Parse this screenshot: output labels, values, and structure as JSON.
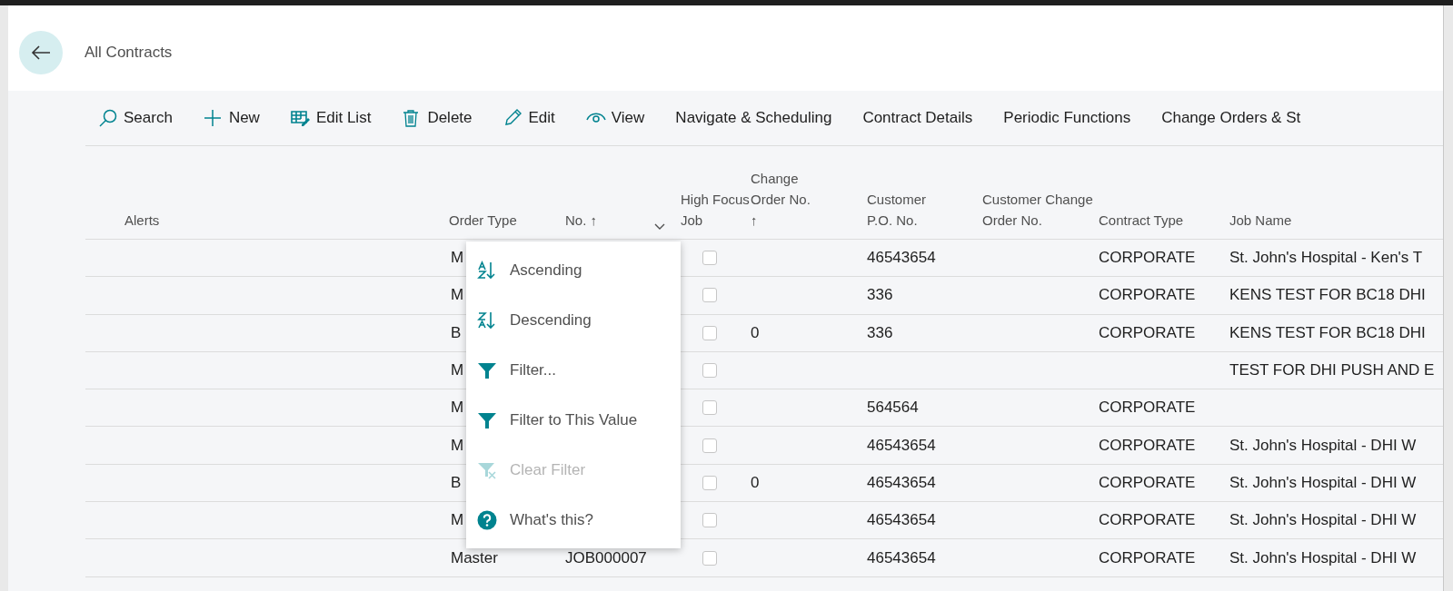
{
  "page": {
    "title": "All Contracts"
  },
  "toolbar": [
    {
      "kind": "search",
      "label": "Search"
    },
    {
      "kind": "new",
      "label": "New"
    },
    {
      "kind": "edit-list",
      "label": "Edit List"
    },
    {
      "kind": "delete",
      "label": "Delete"
    },
    {
      "kind": "edit",
      "label": "Edit"
    },
    {
      "kind": "view",
      "label": "View"
    },
    {
      "kind": "menu",
      "label": "Navigate & Scheduling"
    },
    {
      "kind": "menu",
      "label": "Contract Details"
    },
    {
      "kind": "menu",
      "label": "Periodic Functions"
    },
    {
      "kind": "menu",
      "label": "Change Orders & St"
    }
  ],
  "table": {
    "columns": [
      {
        "label": "Alerts"
      },
      {
        "label": "Order Type"
      },
      {
        "label": "No. ↑",
        "menu_open": true
      },
      {
        "label": "High Focus Job"
      },
      {
        "label": "Change Order No. ↑"
      },
      {
        "label": "Customer P.O. No."
      },
      {
        "label": "Customer Change Order No."
      },
      {
        "label": "Contract Type"
      },
      {
        "label": "Job Name"
      }
    ],
    "rows": [
      {
        "order_type": "M",
        "high_focus": false,
        "customer_po": "46543654",
        "contract_type": "CORPORATE",
        "job_name": "St. John's Hospital - Ken's T"
      },
      {
        "order_type": "M",
        "high_focus": false,
        "customer_po": "336",
        "contract_type": "CORPORATE",
        "job_name": "KENS TEST FOR BC18 DHI"
      },
      {
        "order_type": "B",
        "high_focus": false,
        "change_order": "0",
        "customer_po": "336",
        "contract_type": "CORPORATE",
        "job_name": "KENS TEST FOR BC18 DHI"
      },
      {
        "order_type": "M",
        "high_focus": false,
        "job_name": "TEST FOR DHI PUSH AND E"
      },
      {
        "order_type": "M",
        "high_focus": false,
        "customer_po": "564564",
        "contract_type": "CORPORATE"
      },
      {
        "order_type": "M",
        "high_focus": false,
        "customer_po": "46543654",
        "contract_type": "CORPORATE",
        "job_name": "St. John's Hospital - DHI W"
      },
      {
        "order_type": "B",
        "high_focus": false,
        "change_order": "0",
        "customer_po": "46543654",
        "contract_type": "CORPORATE",
        "job_name": "St. John's Hospital - DHI W"
      },
      {
        "order_type": "M",
        "high_focus": false,
        "customer_po": "46543654",
        "contract_type": "CORPORATE",
        "job_name": "St. John's Hospital - DHI W"
      },
      {
        "order_type": "Master",
        "no": "JOB000007",
        "high_focus": false,
        "customer_po": "46543654",
        "contract_type": "CORPORATE",
        "job_name": "St. John's Hospital - DHI W"
      }
    ]
  },
  "column_menu": [
    {
      "kind": "ascending",
      "label": "Ascending",
      "disabled": false
    },
    {
      "kind": "descending",
      "label": "Descending",
      "disabled": false
    },
    {
      "kind": "filter",
      "label": "Filter...",
      "disabled": false
    },
    {
      "kind": "filter",
      "label": "Filter to This Value",
      "disabled": false
    },
    {
      "kind": "clear-filter",
      "label": "Clear Filter",
      "disabled": true
    },
    {
      "kind": "help",
      "label": "What's this?",
      "disabled": false
    }
  ]
}
